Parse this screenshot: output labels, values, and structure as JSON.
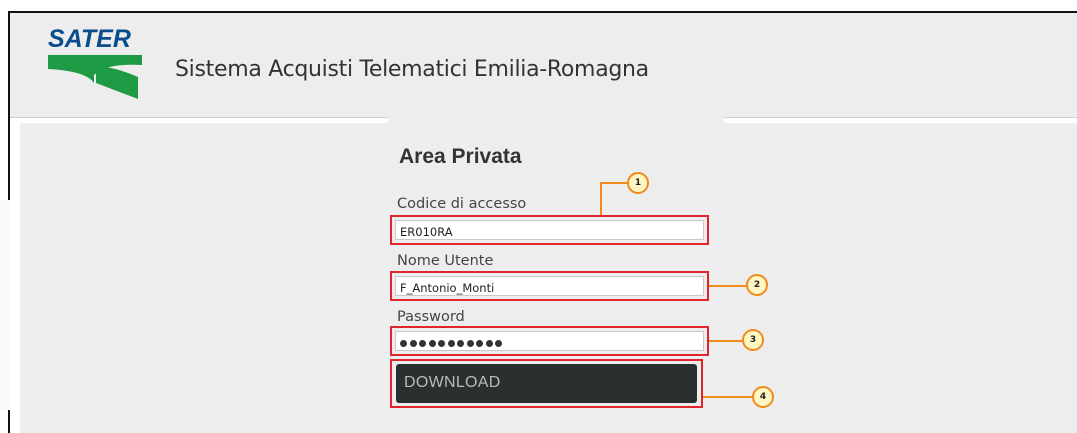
{
  "header": {
    "logo_text": "SATER",
    "site_title": "Sistema Acquisti Telematici Emilia-Romagna"
  },
  "login": {
    "title": "Area Privata",
    "fields": [
      {
        "label": "Codice di accesso",
        "value": "ER010RA"
      },
      {
        "label": "Nome Utente",
        "value": "F_Antonio_Monti"
      },
      {
        "label": "Password",
        "masked_length": 11
      }
    ],
    "button_label": "DOWNLOAD"
  },
  "callouts": [
    "1",
    "2",
    "3",
    "4"
  ],
  "colors": {
    "highlight": "#e0262c",
    "callout": "#f08a1c",
    "button_bg": "#2a3030",
    "logo_blue": "#0a4d8c",
    "logo_green": "#1f9a45"
  }
}
